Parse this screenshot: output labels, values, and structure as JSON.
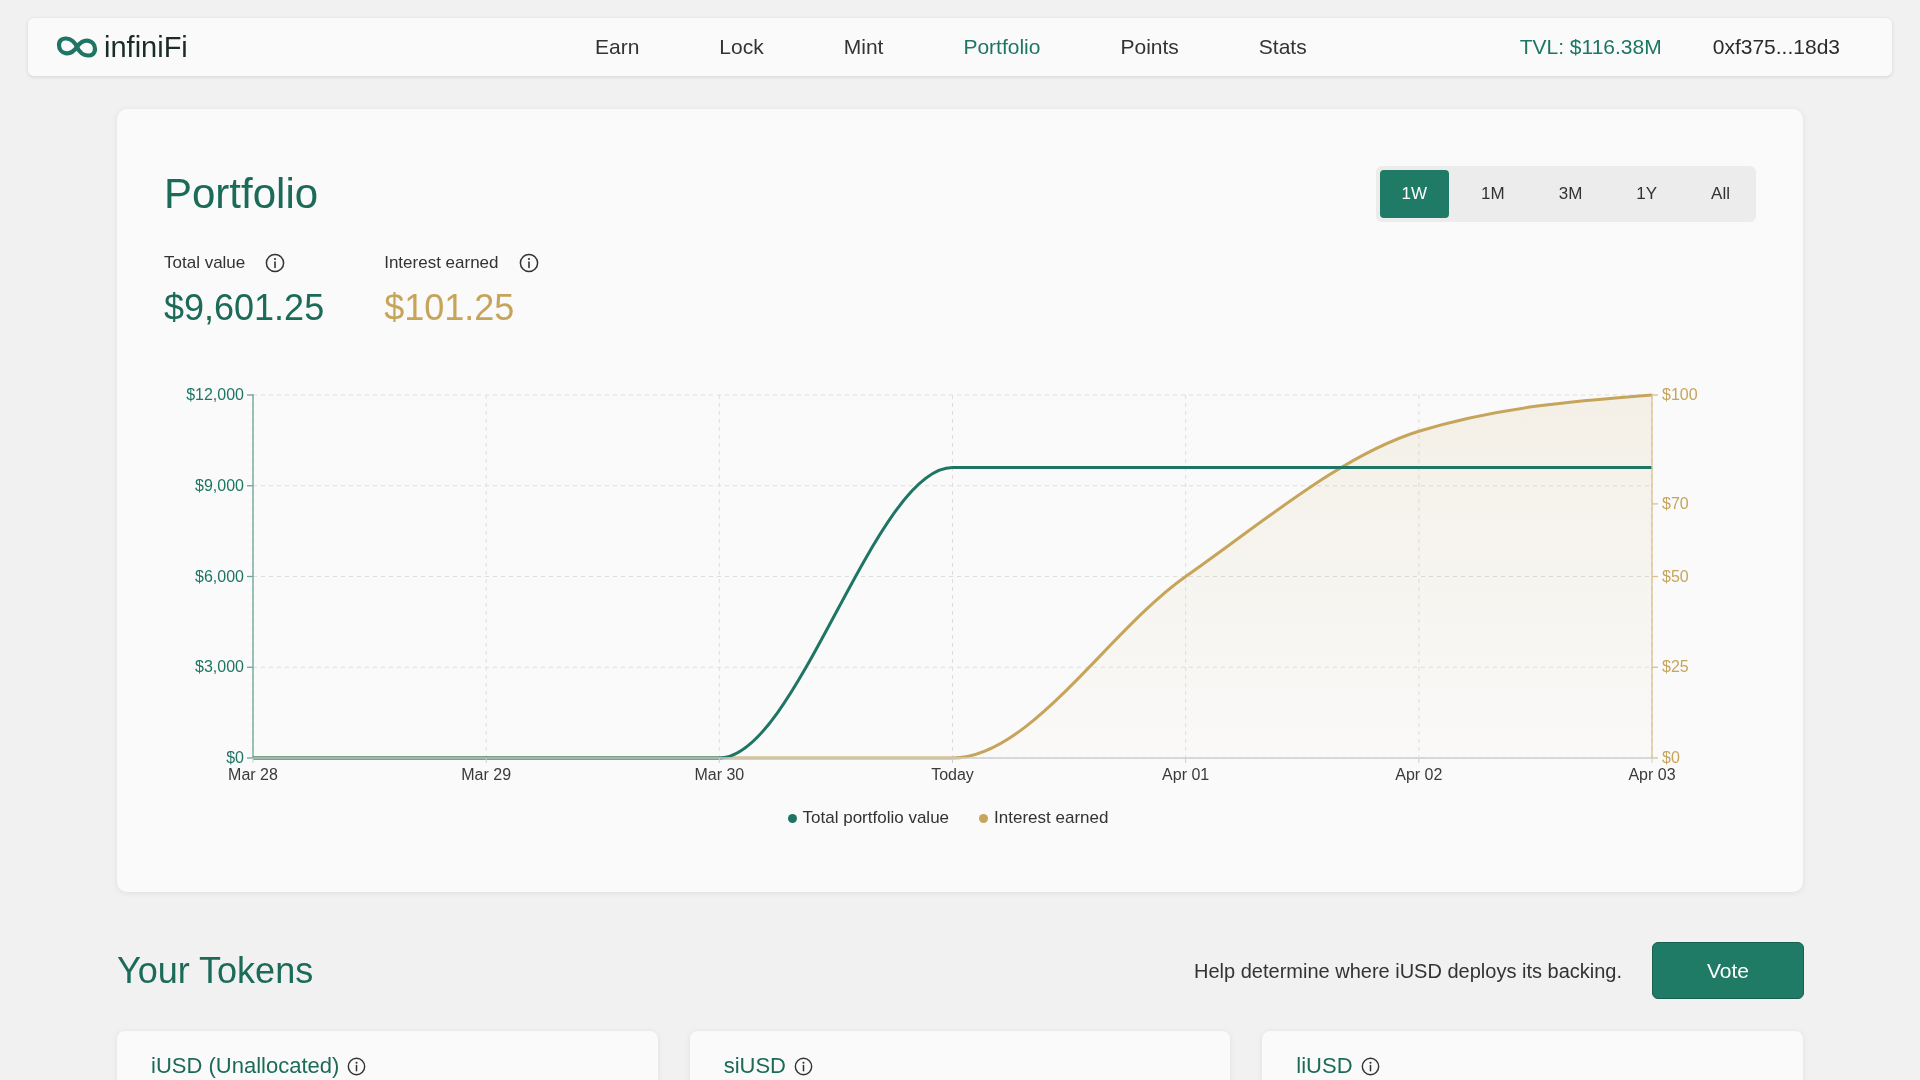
{
  "nav": {
    "brand": "infiniFi",
    "links": [
      {
        "label": "Earn",
        "selected": false
      },
      {
        "label": "Lock",
        "selected": false
      },
      {
        "label": "Mint",
        "selected": false
      },
      {
        "label": "Portfolio",
        "selected": true
      },
      {
        "label": "Points",
        "selected": false
      },
      {
        "label": "Stats",
        "selected": false
      }
    ],
    "tvl": "TVL: $116.38M",
    "wallet": "0xf375...18d3"
  },
  "portfolio": {
    "title": "Portfolio",
    "ranges": [
      {
        "label": "1W",
        "selected": true
      },
      {
        "label": "1M",
        "selected": false
      },
      {
        "label": "3M",
        "selected": false
      },
      {
        "label": "1Y",
        "selected": false
      },
      {
        "label": "All",
        "selected": false
      }
    ],
    "stats": [
      {
        "kind": "total",
        "label": "Total value",
        "value": "$9,601.25"
      },
      {
        "kind": "interest",
        "label": "Interest earned",
        "value": "$101.25"
      }
    ],
    "chart_data": {
      "type": "line",
      "categories": [
        "Mar 28",
        "Mar 29",
        "Mar 30",
        "Today",
        "Apr 01",
        "Apr 02",
        "Apr 03"
      ],
      "series": [
        {
          "name": "Total portfolio value",
          "color": "#1e7563",
          "type": "line",
          "values": [
            0,
            0,
            0,
            9600,
            9600,
            9600,
            9600
          ]
        },
        {
          "name": "Interest earned",
          "color": "#c6a55b",
          "type": "area",
          "axis": "y2",
          "values": [
            0,
            0,
            0,
            0,
            50,
            90,
            100
          ]
        }
      ],
      "ylim": [
        0,
        12000
      ],
      "yticks": [
        {
          "value": 0,
          "label": "$0"
        },
        {
          "value": 3000,
          "label": "$3,000"
        },
        {
          "value": 6000,
          "label": "$6,000"
        },
        {
          "value": 9000,
          "label": "$9,000"
        },
        {
          "value": 12000,
          "label": "$12,000"
        }
      ],
      "y2lim": [
        0,
        100
      ],
      "y2ticks": [
        {
          "value": 0,
          "label": "$0"
        },
        {
          "value": 25,
          "label": "$25"
        },
        {
          "value": 50,
          "label": "$50"
        },
        {
          "value": 70,
          "label": "$70"
        },
        {
          "value": 100,
          "label": "$100"
        }
      ],
      "grid": true
    }
  },
  "tokens": {
    "title": "Your Tokens",
    "hint": "Help determine where iUSD deploys its backing.",
    "vote_button": "Vote",
    "cards": [
      {
        "title": "iUSD (Unallocated)"
      },
      {
        "title": "siUSD"
      },
      {
        "title": "liUSD"
      }
    ]
  }
}
